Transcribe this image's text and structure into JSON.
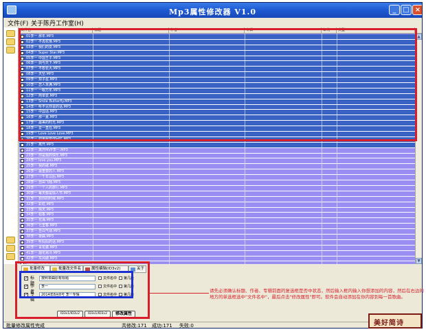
{
  "window": {
    "title": "Mp3属性修改器 V1.0"
  },
  "menu": {
    "items": [
      "文件(F)",
      "关于陈丹工作室(H)"
    ]
  },
  "grid": {
    "columns": [
      "文件名",
      "标题",
      "作者",
      "专辑",
      "年代",
      "类型"
    ],
    "selected_rows": [
      "01李一 那年.MP3",
      "02李一 不再犹豫.MP3",
      "03李一 我们的爱.MP3",
      "04李一 Super Star.MP3",
      "05李一 中国王子.MP3",
      "06李一 剑与天下.MP3",
      "07李一 不想长大.MP3",
      "08李一 天空.MP3",
      "09李一 双子星.MP3",
      "10李一 恋人未满.MP3",
      "11李一 一眼万年.MP3",
      "12李一 简单爱.MP3",
      "13李一 Smile Butterfly.MP3",
      "14李一 听不见你说的话.MP3",
      "15李一 中国话.MP3",
      "16李一 那一夏.MP3",
      "17李一 最美的时光.MP3",
      "18李一 爱一直在.MP3",
      "19李一 Love Love Love.MP3",
      "20李一 如果我变成回忆.MP3",
      "21李一 离开.MP3"
    ],
    "unselected_rows": [
      "22李一 离开MVP李一.MP3",
      "23李一 你是我的快乐.MP3",
      "24李一 love you.MP3",
      "25李一 我的歌.MP3",
      "26李一 最重要的人.MP3",
      "27李一 一千年以后.MP3",
      "28李一 自由飞翔.MP3",
      "29李一 一个人的旅行.MP3",
      "30李一 每天都是情人节.MP3",
      "31李一 想你的时候.MP3",
      "32李一 彩虹.MP3",
      "33李一 晴天.MP3",
      "34李一 稻香.MP3",
      "35李一 花海.MP3",
      "36李一 七里香.MP3",
      "37李一 告白气球.MP3",
      "38李一 夜曲.MP3",
      "39李一 听妈妈的话.MP3",
      "40李一 青花瓷.MP3",
      "41李一 烟花易冷.MP3",
      "42李一 东风破.MP3",
      "43李一 简单爱.MP3",
      "44李一 园游会.MP3",
      "45李一 说好的幸福呢.MP3",
      "46李一 不能说的秘密.MP3",
      "47李一 安静.MP3",
      "48李一 给我一首歌的时间.MP3"
    ]
  },
  "tabs": [
    "批量修改",
    "批量改文件名",
    "属性编辑(ID3v2)",
    "关于"
  ],
  "fields": [
    {
      "label": "标题",
      "value": "按照单曲原有标题",
      "opt1": "文件名中",
      "opt2": "第几段"
    },
    {
      "label": "作者",
      "value": "李一",
      "opt1": "文件名中",
      "opt2": "第几段"
    },
    {
      "label": "专辑",
      "value": "2014年8月8号 李一专辑",
      "opt1": "文件名中",
      "opt2": "第几段"
    }
  ],
  "buttons": {
    "id3v1": "ID3v1/ID3v2",
    "id3v2": "ID3v1/ID3v2",
    "apply": "修改属性"
  },
  "instructions": "请先必须确认标题、作者、专辑前面的复选框是否中状态，然后输入框内输入你想添加的内容，然后在右边的地方的单选框选中\"文件名中\"，最后点击\"修改属性\"即可。软件会自动添加在你内容到每一首歌曲。",
  "status": {
    "left": "批量修改属性完成",
    "count": "共修改:171",
    "success": "成功:171",
    "fail": "失败:0"
  },
  "stamp": "美好简诗"
}
